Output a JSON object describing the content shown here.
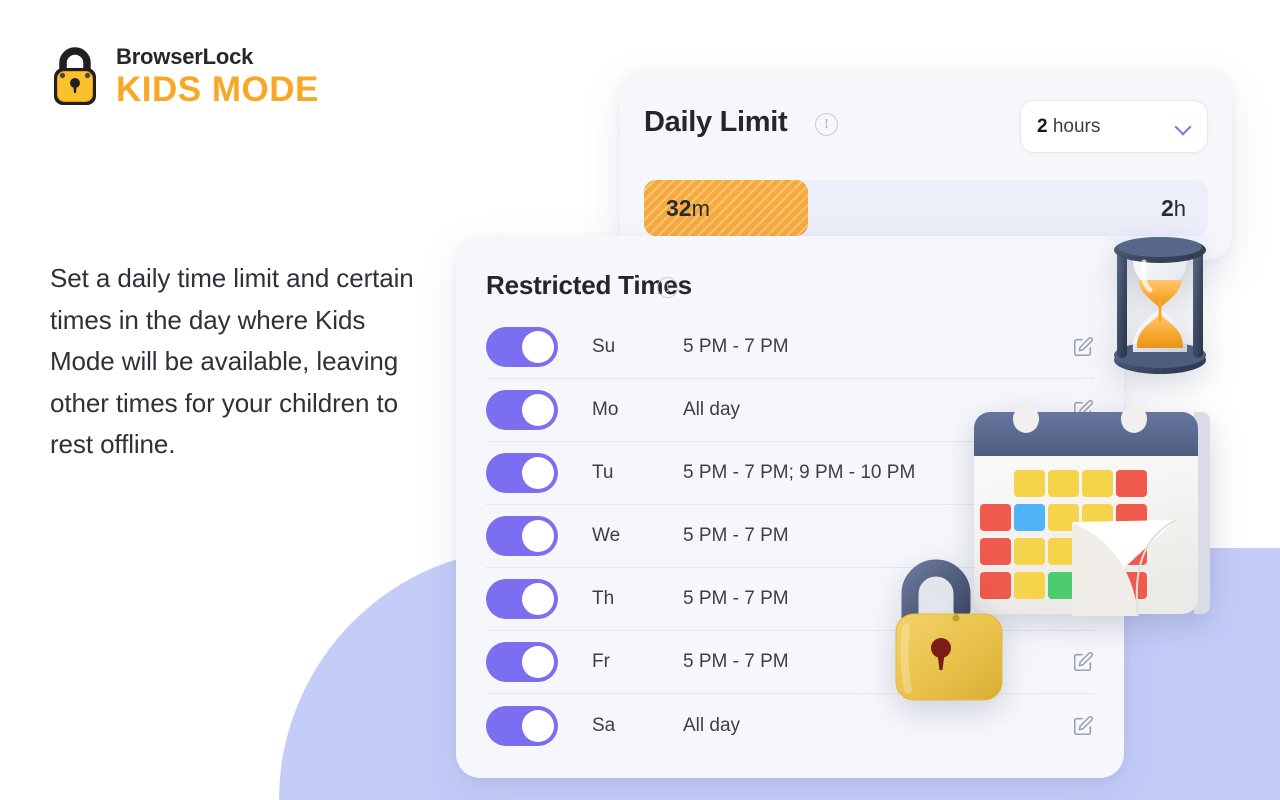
{
  "brand": {
    "name": "BrowserLock",
    "product": "KIDS MODE",
    "logo_icon": "padlock-icon",
    "accent_orange": "#f9a825",
    "accent_purple": "#7c6ef0"
  },
  "description": "Set a daily time limit and certain times in the day where Kids Mode will be available, leaving other times for your children to rest offline.",
  "daily_limit": {
    "title": "Daily Limit",
    "info_icon": "info-circle-icon",
    "info_glyph": "!",
    "select": {
      "value_number": "2",
      "value_unit": " hours",
      "full_value": "2 hours",
      "chevron_icon": "chevron-down-icon"
    },
    "progress": {
      "used_number": "32",
      "used_unit": "m",
      "used_label": "32m",
      "total_number": "2",
      "total_unit": "h",
      "total_label": "2h",
      "percent": 29,
      "fill_color": "#f7aa3c",
      "track_color": "#eceefa"
    }
  },
  "restricted_times": {
    "title": "Restricted Times",
    "info_icon": "info-circle-icon",
    "info_glyph": "!",
    "rows": [
      {
        "day": "Su",
        "time": "5 PM - 7 PM",
        "enabled": true,
        "edit_icon": "edit-pencil-icon"
      },
      {
        "day": "Mo",
        "time": "All day",
        "enabled": true,
        "edit_icon": "edit-pencil-icon"
      },
      {
        "day": "Tu",
        "time": "5 PM - 7 PM;  9 PM - 10 PM",
        "enabled": true,
        "edit_icon": "edit-pencil-icon"
      },
      {
        "day": "We",
        "time": "5 PM - 7 PM",
        "enabled": true,
        "edit_icon": "edit-pencil-icon"
      },
      {
        "day": "Th",
        "time": "5 PM - 7 PM",
        "enabled": true,
        "edit_icon": "edit-pencil-icon"
      },
      {
        "day": "Fr",
        "time": "5 PM - 7 PM",
        "enabled": true,
        "edit_icon": "edit-pencil-icon"
      },
      {
        "day": "Sa",
        "time": "All day",
        "enabled": true,
        "edit_icon": "edit-pencil-icon"
      }
    ]
  },
  "illustrations": [
    {
      "name": "hourglass-illustration",
      "frame_color": "#3d4a63",
      "sand_color": "#f5a93b"
    },
    {
      "name": "calendar-illustration",
      "header_color": "#5a6b92",
      "body_color": "#f6f3ef",
      "tile_colors": [
        "#f5d44c",
        "#ef5a4c",
        "#4fb3f5",
        "#4dcc6e"
      ]
    },
    {
      "name": "padlock-illustration",
      "body_color": "#edc34a",
      "shackle_color": "#4a5878",
      "keyhole_color": "#7a1d16"
    }
  ],
  "background": {
    "blob_color": "#c4ccf8",
    "page_color": "#ffffff"
  }
}
